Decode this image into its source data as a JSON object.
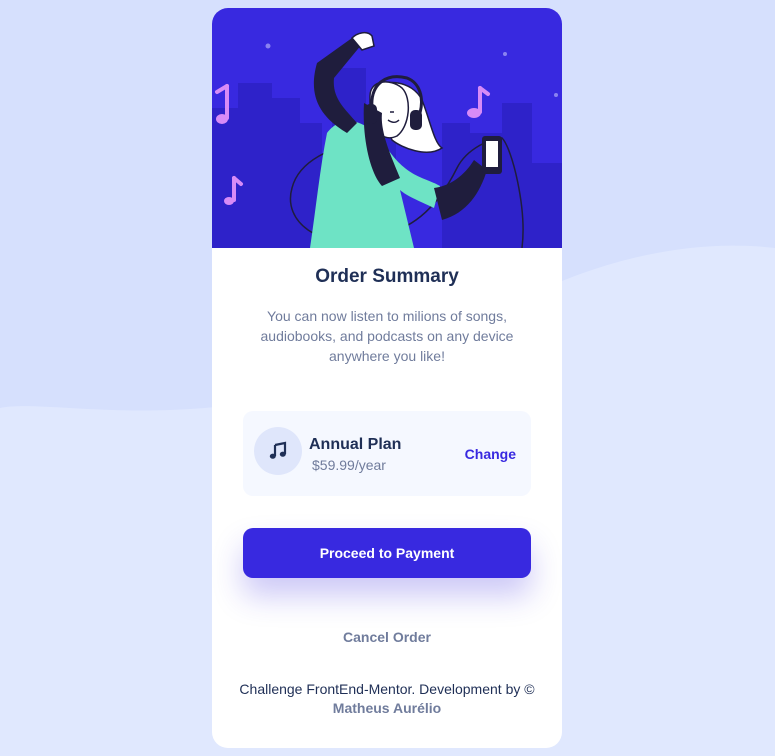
{
  "page": {
    "title": "Order Summary",
    "description": "You can now listen to milions of songs, audiobooks, and podcasts on any device anywhere you like!"
  },
  "plan": {
    "icon": "music-note-icon",
    "name": "Annual Plan",
    "price": "$59.99/year",
    "change_label": "Change"
  },
  "actions": {
    "proceed_label": "Proceed to Payment",
    "cancel_label": "Cancel Order"
  },
  "footer": {
    "text_prefix": "Challenge FrontEnd-Mentor. Development by ©",
    "author": "Matheus Aurélio"
  },
  "colors": {
    "page_background": "#e0e8fe",
    "accent": "#3829e0",
    "figure_shirt": "#6ee3c5",
    "music_notes": "#d78bf7",
    "text_dark": "#1f2f56",
    "text_muted": "#707c9c"
  },
  "hero_illustration": {
    "icon": "person-listening-music-illustration"
  }
}
